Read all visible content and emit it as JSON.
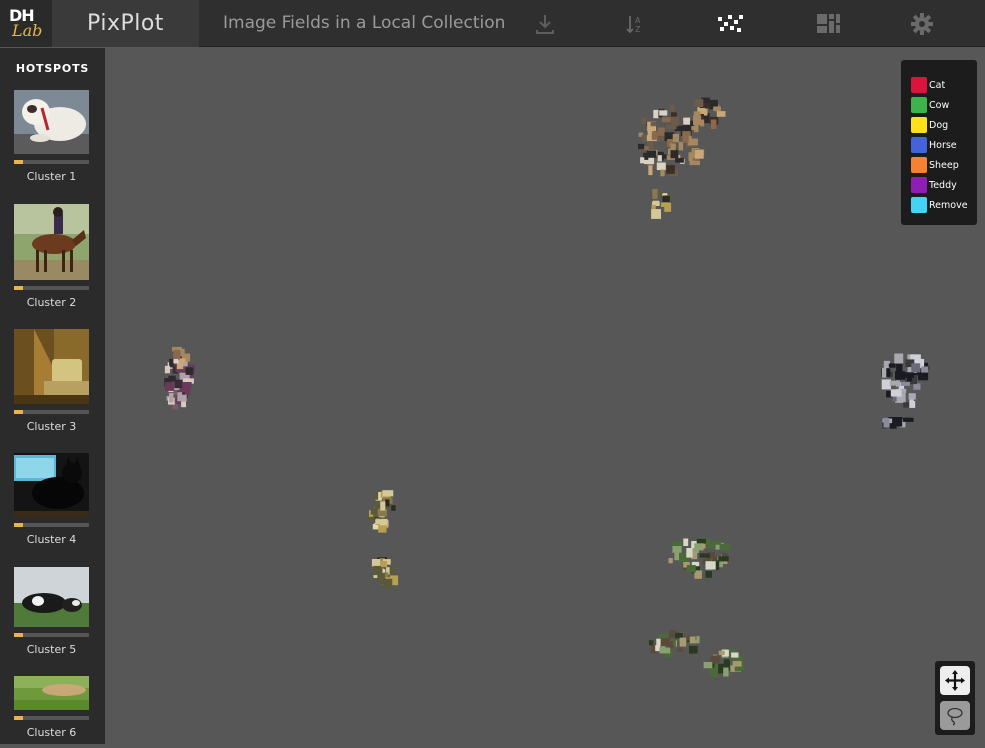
{
  "header": {
    "logo_top": "DH",
    "logo_bottom": "Lab",
    "app_name": "PixPlot",
    "collection_title": "Image Fields in a Local Collection",
    "icons": [
      "download-icon",
      "sort-icon",
      "scatter-layout-icon",
      "grid-layout-icon",
      "settings-icon"
    ]
  },
  "sidebar": {
    "title": "HOTSPOTS",
    "hotspots": [
      {
        "label": "Cluster 1",
        "image": "bulldog-photo",
        "progress": 0.12
      },
      {
        "label": "Cluster 2",
        "image": "horse-rider-photo",
        "progress": 0.12
      },
      {
        "label": "Cluster 3",
        "image": "chair-photo",
        "progress": 0.12
      },
      {
        "label": "Cluster 4",
        "image": "cat-monitor-photo",
        "progress": 0.12
      },
      {
        "label": "Cluster 5",
        "image": "cow-field-photo",
        "progress": 0.12
      },
      {
        "label": "Cluster 6",
        "image": "sheep-field-photo",
        "progress": 0.12
      }
    ]
  },
  "legend": {
    "items": [
      {
        "label": "Cat",
        "color": "#dc143c"
      },
      {
        "label": "Cow",
        "color": "#3cb44b"
      },
      {
        "label": "Dog",
        "color": "#ffe119"
      },
      {
        "label": "Horse",
        "color": "#4363d8"
      },
      {
        "label": "Sheep",
        "color": "#f58231"
      },
      {
        "label": "Teddy",
        "color": "#911eb4"
      },
      {
        "label": "Remove",
        "color": "#42d4f4"
      }
    ]
  },
  "controls": {
    "pan_icon": "move-arrows-icon",
    "lasso_icon": "lasso-icon"
  },
  "colors": {
    "accent": "#e9b44c",
    "background": "#575757",
    "header": "#2f2f2f",
    "sidebar": "#2b2b2b"
  }
}
